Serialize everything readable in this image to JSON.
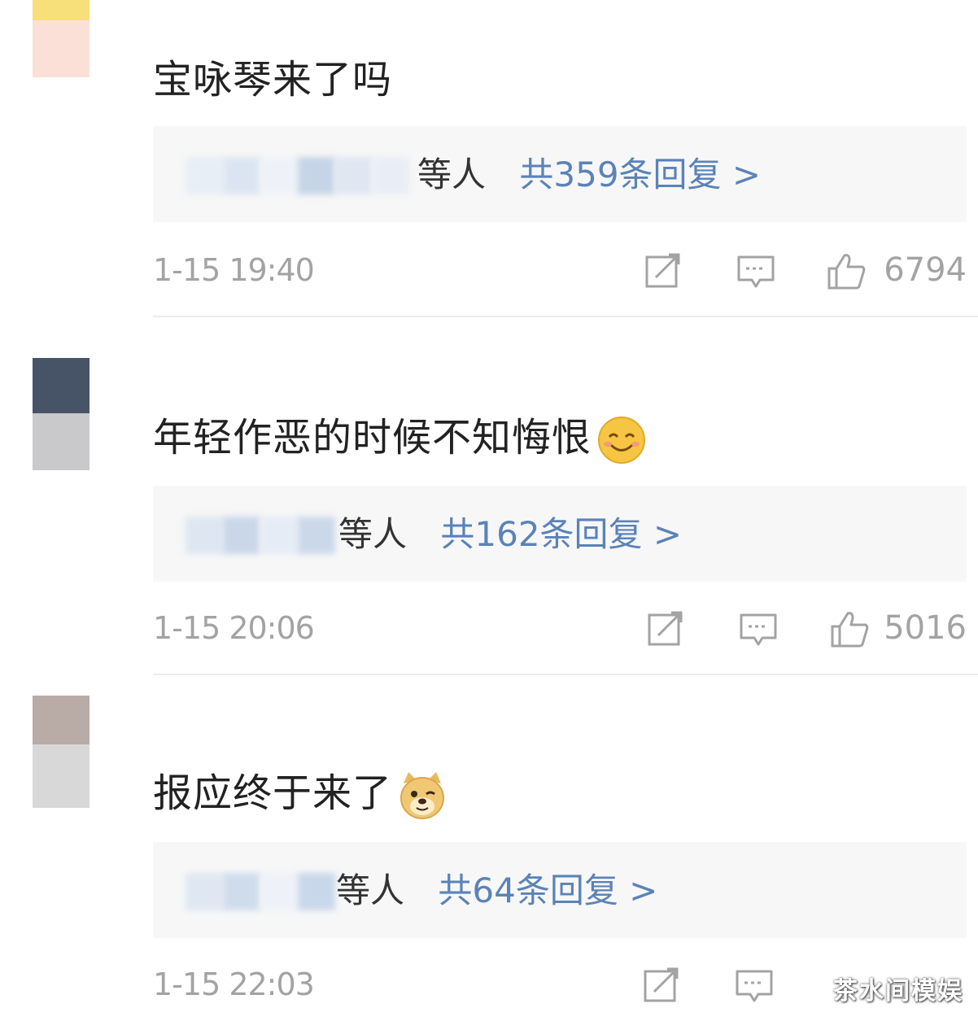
{
  "comments": [
    {
      "text": "宝咏琴来了吗",
      "emoji": "",
      "reply_others": "等人",
      "reply_count": "共359条回复 >",
      "time": "1-15 19:40",
      "likes": "6794"
    },
    {
      "text": "年轻作恶的时候不知悔恨",
      "emoji": "smile-emoji",
      "reply_others": "等人",
      "reply_count": "共162条回复 >",
      "time": "1-15 20:06",
      "likes": "5016"
    },
    {
      "text": "报应终于来了",
      "emoji": "doge-emoji",
      "reply_others": "等人",
      "reply_count": "共64条回复 >",
      "time": "1-15 22:03",
      "likes": ""
    }
  ],
  "watermark": "茶水间模娱",
  "colors": {
    "link_blue": "#5a83b8",
    "meta_gray": "#a3a3a3",
    "reply_bg": "#f7f7f7"
  }
}
